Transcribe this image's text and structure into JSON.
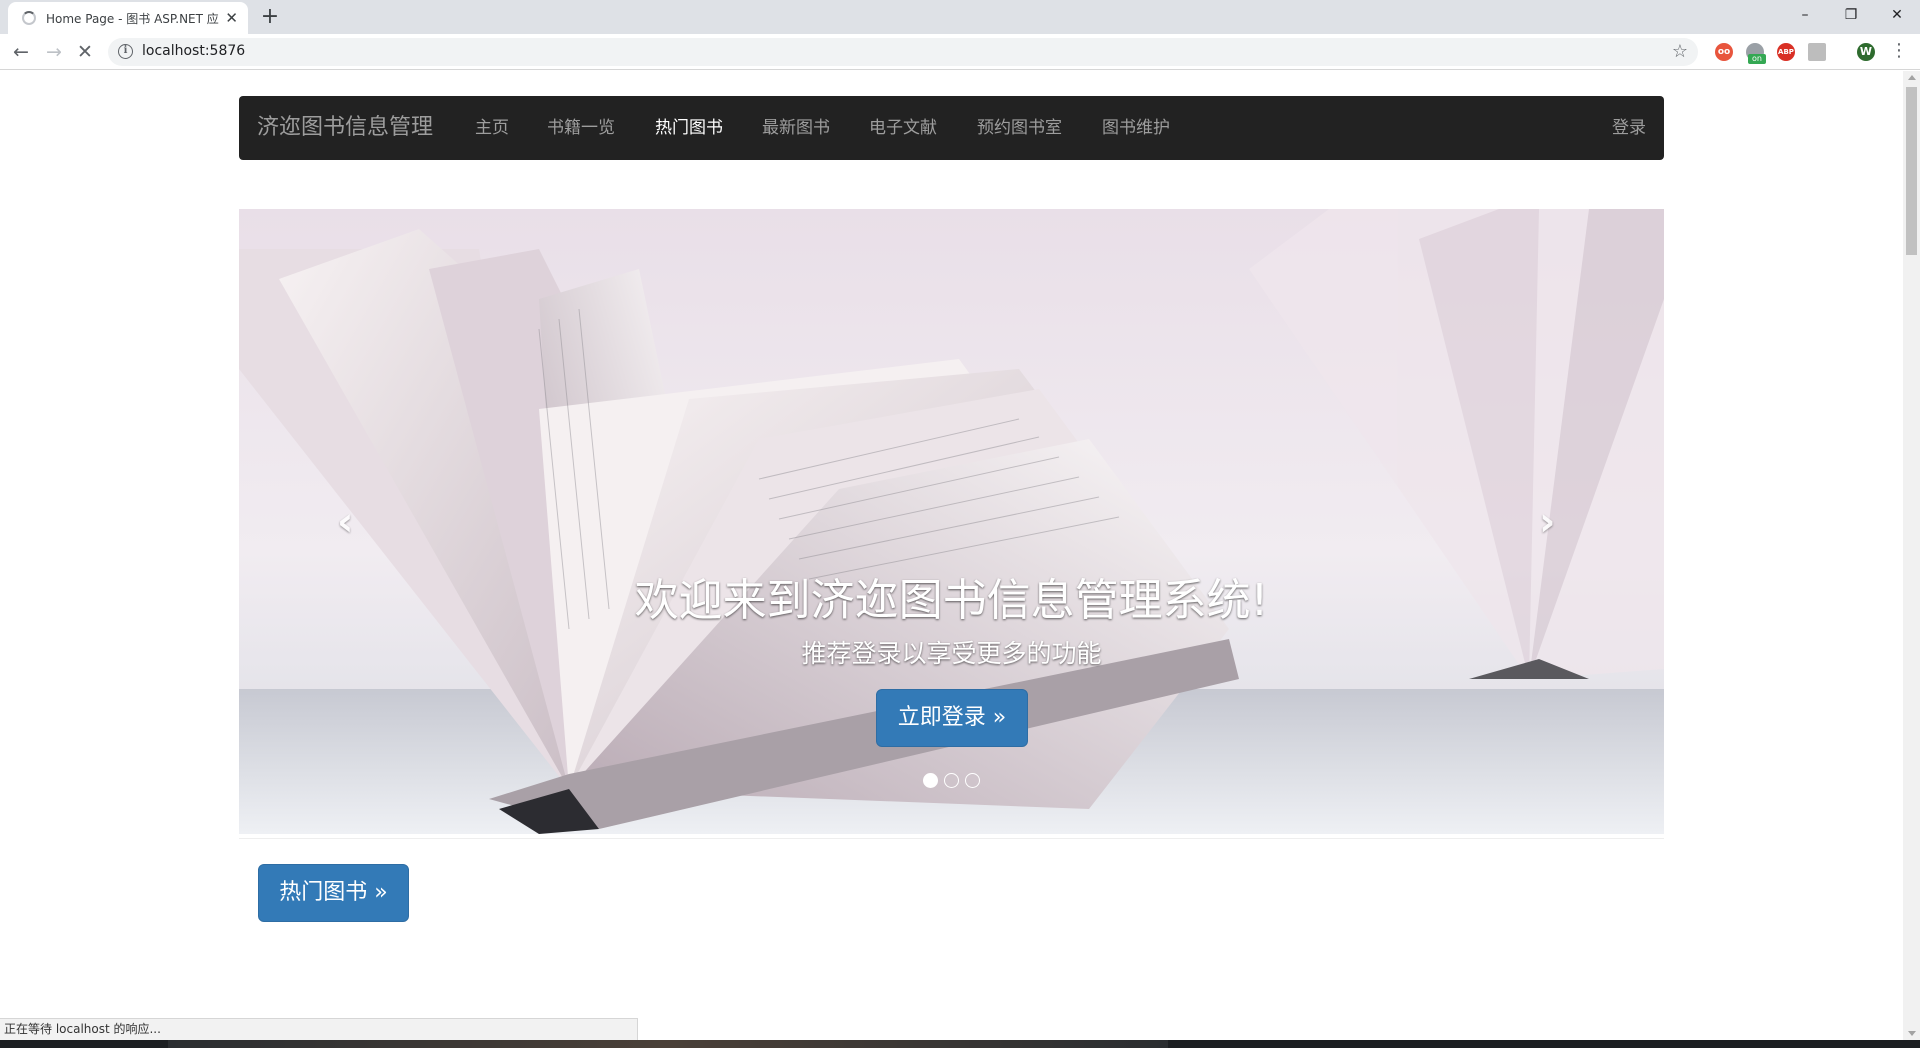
{
  "browser": {
    "tab_title": "Home Page - 图书 ASP.NET 应",
    "new_tab": "+",
    "url": "localhost:5876",
    "window_controls": [
      "–",
      "❐",
      "✕"
    ],
    "extensions": [
      {
        "name": "extension-ublock-icon",
        "color": "#e8553d"
      },
      {
        "name": "extension-vpn-icon",
        "color": "#9aa0a6",
        "badge": "on"
      },
      {
        "name": "extension-adblock-icon",
        "color": "#d93025",
        "label": "ABP"
      },
      {
        "name": "extension-translate-icon",
        "color": "#bdbdbd"
      },
      {
        "name": "profile-avatar",
        "color": "#2e6b2e",
        "label": "W"
      }
    ]
  },
  "site": {
    "brand": "济迩图书信息管理",
    "nav": [
      {
        "label": "主页",
        "active": false
      },
      {
        "label": "书籍一览",
        "active": false
      },
      {
        "label": "热门图书",
        "active": true
      },
      {
        "label": "最新图书",
        "active": false
      },
      {
        "label": "电子文献",
        "active": false
      },
      {
        "label": "预约图书室",
        "active": false
      },
      {
        "label": "图书维护",
        "active": false
      }
    ],
    "login": "登录"
  },
  "carousel": {
    "title": "欢迎来到济迩图书信息管理系统!",
    "subtitle": "推荐登录以享受更多的功能",
    "button": "立即登录 »",
    "prev": "‹",
    "next": "›",
    "slides": 3,
    "active_slide": 1
  },
  "section": {
    "button": "热门图书 »"
  },
  "status": "正在等待 localhost 的响应...",
  "colors": {
    "navbar_bg": "#222222",
    "nav_text": "#9d9d9d",
    "primary": "#337ab7"
  }
}
